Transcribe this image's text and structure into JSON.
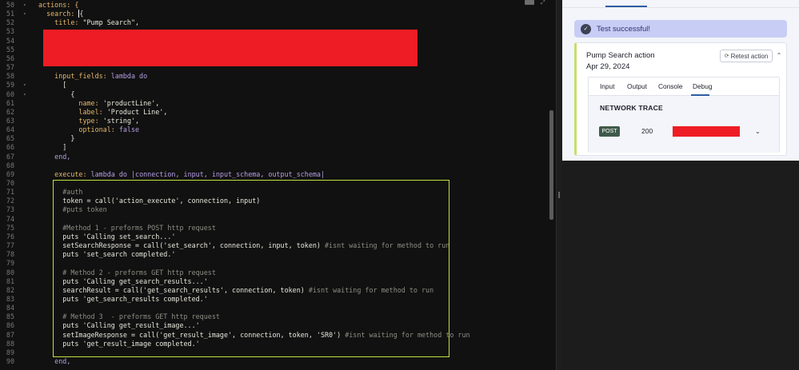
{
  "editor": {
    "lines": [
      {
        "n": "50",
        "fold": "▾",
        "segs": [
          {
            "t": "actions: {",
            "c": "t-key"
          }
        ]
      },
      {
        "n": "51",
        "fold": "▾",
        "segs": [
          {
            "t": "  search: ",
            "c": "t-key"
          },
          {
            "t": "{",
            "c": "t-cur"
          }
        ]
      },
      {
        "n": "52",
        "fold": "",
        "segs": [
          {
            "t": "    title: ",
            "c": "t-key"
          },
          {
            "t": "\"Pump Search\",",
            "c": "t-str"
          }
        ]
      },
      {
        "n": "53",
        "fold": "",
        "segs": []
      },
      {
        "n": "54",
        "fold": "",
        "segs": []
      },
      {
        "n": "55",
        "fold": "",
        "segs": []
      },
      {
        "n": "56",
        "fold": "",
        "segs": []
      },
      {
        "n": "57",
        "fold": "",
        "segs": []
      },
      {
        "n": "58",
        "fold": "",
        "segs": [
          {
            "t": "    input_fields: ",
            "c": "t-key"
          },
          {
            "t": "lambda do",
            "c": "t-kw"
          }
        ]
      },
      {
        "n": "59",
        "fold": "▾",
        "segs": [
          {
            "t": "      [",
            "c": "t-str"
          }
        ]
      },
      {
        "n": "60",
        "fold": "▾",
        "segs": [
          {
            "t": "        {",
            "c": "t-str"
          }
        ]
      },
      {
        "n": "61",
        "fold": "",
        "segs": [
          {
            "t": "          name: ",
            "c": "t-key"
          },
          {
            "t": "'productLine',",
            "c": "t-str"
          }
        ]
      },
      {
        "n": "62",
        "fold": "",
        "segs": [
          {
            "t": "          label: ",
            "c": "t-key"
          },
          {
            "t": "'Product Line',",
            "c": "t-str"
          }
        ]
      },
      {
        "n": "63",
        "fold": "",
        "segs": [
          {
            "t": "          type: ",
            "c": "t-key"
          },
          {
            "t": "'string',",
            "c": "t-str"
          }
        ]
      },
      {
        "n": "64",
        "fold": "",
        "segs": [
          {
            "t": "          optional: ",
            "c": "t-key"
          },
          {
            "t": "false",
            "c": "t-kw"
          }
        ]
      },
      {
        "n": "65",
        "fold": "",
        "segs": [
          {
            "t": "        }",
            "c": "t-str"
          }
        ]
      },
      {
        "n": "66",
        "fold": "",
        "segs": [
          {
            "t": "      ]",
            "c": "t-str"
          }
        ]
      },
      {
        "n": "67",
        "fold": "",
        "segs": [
          {
            "t": "    end,",
            "c": "t-kw"
          }
        ]
      },
      {
        "n": "68",
        "fold": "",
        "segs": []
      },
      {
        "n": "69",
        "fold": "",
        "segs": [
          {
            "t": "    execute: ",
            "c": "t-key"
          },
          {
            "t": "lambda do ",
            "c": "t-kw"
          },
          {
            "t": "|connection, input, input_schema, output_schema|",
            "c": "t-kw"
          }
        ]
      },
      {
        "n": "70",
        "fold": "",
        "segs": []
      },
      {
        "n": "71",
        "fold": "",
        "segs": [
          {
            "t": "      #auth",
            "c": "t-com"
          }
        ]
      },
      {
        "n": "72",
        "fold": "",
        "segs": [
          {
            "t": "      token = call('action_execute', connection, input)",
            "c": "t-str"
          }
        ]
      },
      {
        "n": "73",
        "fold": "",
        "segs": [
          {
            "t": "      #puts token",
            "c": "t-com"
          }
        ]
      },
      {
        "n": "74",
        "fold": "",
        "segs": []
      },
      {
        "n": "75",
        "fold": "",
        "segs": [
          {
            "t": "      #Method 1 - preforms POST http request",
            "c": "t-com"
          }
        ]
      },
      {
        "n": "76",
        "fold": "",
        "segs": [
          {
            "t": "      puts 'Calling set_search...'",
            "c": "t-str"
          }
        ]
      },
      {
        "n": "77",
        "fold": "",
        "segs": [
          {
            "t": "      setSearchResponse = call('set_search', connection, input, token) ",
            "c": "t-str"
          },
          {
            "t": "#isnt waiting for method to run",
            "c": "t-com"
          }
        ]
      },
      {
        "n": "78",
        "fold": "",
        "segs": [
          {
            "t": "      puts 'set_search completed.'",
            "c": "t-str"
          }
        ]
      },
      {
        "n": "79",
        "fold": "",
        "segs": []
      },
      {
        "n": "80",
        "fold": "",
        "segs": [
          {
            "t": "      # Method 2 - preforms GET http request",
            "c": "t-com"
          }
        ]
      },
      {
        "n": "81",
        "fold": "",
        "segs": [
          {
            "t": "      puts 'Calling get_search_results...'",
            "c": "t-str"
          }
        ]
      },
      {
        "n": "82",
        "fold": "",
        "segs": [
          {
            "t": "      searchResult = call('get_search_results', connection, token) ",
            "c": "t-str"
          },
          {
            "t": "#isnt waiting for method to run",
            "c": "t-com"
          }
        ]
      },
      {
        "n": "83",
        "fold": "",
        "segs": [
          {
            "t": "      puts 'get_search_results completed.'",
            "c": "t-str"
          }
        ]
      },
      {
        "n": "84",
        "fold": "",
        "segs": []
      },
      {
        "n": "85",
        "fold": "",
        "segs": [
          {
            "t": "      # Method 3  - preforms GET http request",
            "c": "t-com"
          }
        ]
      },
      {
        "n": "86",
        "fold": "",
        "segs": [
          {
            "t": "      puts 'Calling get_result_image...'",
            "c": "t-str"
          }
        ]
      },
      {
        "n": "87",
        "fold": "",
        "segs": [
          {
            "t": "      setImageResponse = call('get_result_image', connection, token, 'SR0') ",
            "c": "t-str"
          },
          {
            "t": "#isnt waiting for method to run",
            "c": "t-com"
          }
        ]
      },
      {
        "n": "88",
        "fold": "",
        "segs": [
          {
            "t": "      puts 'get_result_image completed.'",
            "c": "t-str"
          }
        ]
      },
      {
        "n": "89",
        "fold": "",
        "segs": []
      },
      {
        "n": "90",
        "fold": "",
        "segs": [
          {
            "t": "    end,",
            "c": "t-kw"
          }
        ]
      }
    ]
  },
  "panel": {
    "toast": {
      "icon": "check-badge-icon",
      "text": "Test successful!"
    },
    "card": {
      "title": "Pump Search action",
      "date": "Apr 29, 2024",
      "retest_label": "Retest action",
      "tabs": [
        "Input",
        "Output",
        "Console",
        "Debug"
      ],
      "active_tab": "Debug",
      "network_trace": {
        "title": "NETWORK TRACE",
        "method": "POST",
        "status": "200"
      }
    }
  },
  "colors": {
    "accent": "#2f5ea3",
    "toast_bg": "#c8cdf5",
    "card_accent": "#c6e06a",
    "highlight_border": "#c0e040",
    "redaction": "#ee1c24",
    "post_badge": "#3f5a4a"
  }
}
